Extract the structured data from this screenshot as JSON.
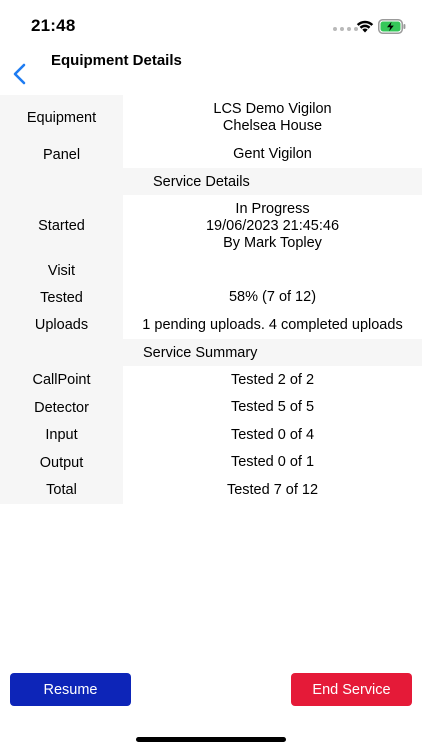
{
  "status_bar": {
    "time": "21:48"
  },
  "nav": {
    "title": "Equipment Details"
  },
  "details": {
    "equipment": {
      "label": "Equipment",
      "line1": "LCS Demo Vigilon",
      "line2": "Chelsea House"
    },
    "panel": {
      "label": "Panel",
      "value": "Gent Vigilon"
    },
    "service_details_header": "Service Details",
    "started": {
      "label": "Started",
      "line1": "In Progress",
      "line2": "19/06/2023 21:45:46",
      "line3": "By Mark Topley"
    },
    "visit": {
      "label": "Visit",
      "value": ""
    },
    "tested": {
      "label": "Tested",
      "value": "58% (7 of 12)"
    },
    "uploads": {
      "label": "Uploads",
      "value": "1 pending uploads. 4 completed uploads"
    },
    "service_summary_header": "Service Summary",
    "summary": [
      {
        "label": "CallPoint",
        "value": "Tested 2 of 2"
      },
      {
        "label": "Detector",
        "value": "Tested 5 of 5"
      },
      {
        "label": "Input",
        "value": "Tested 0 of 4"
      },
      {
        "label": "Output",
        "value": "Tested 0 of 1"
      },
      {
        "label": "Total",
        "value": "Tested 7 of 12"
      }
    ]
  },
  "actions": {
    "resume_label": "Resume",
    "end_service_label": "End Service"
  },
  "colors": {
    "accent": "#1e7cf2",
    "resume": "#0d25b8",
    "end_service": "#e51a38",
    "label_bg": "#f6f6f6"
  },
  "icons": [
    "wifi-icon",
    "battery-charging-icon",
    "chevron-left-icon"
  ]
}
